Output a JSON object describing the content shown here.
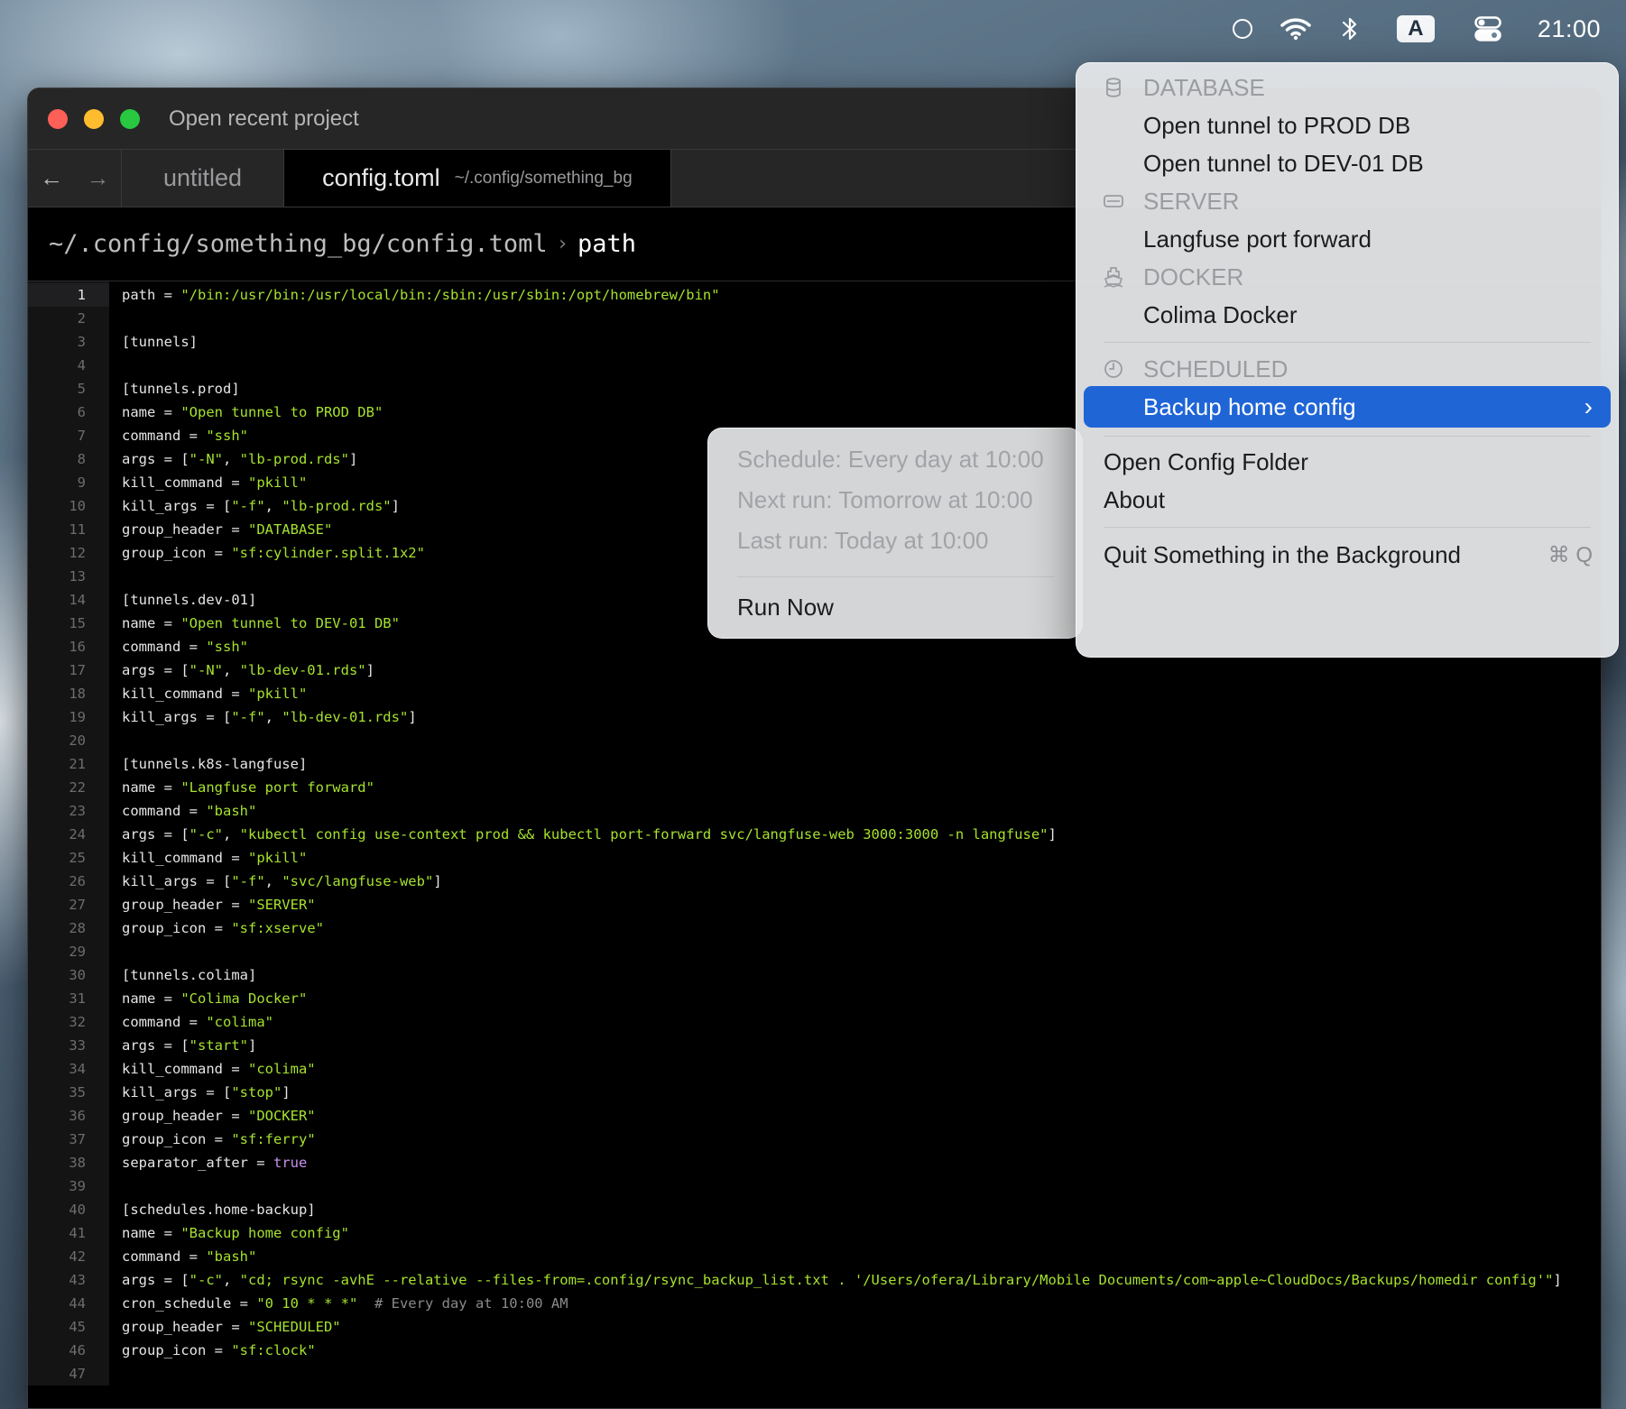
{
  "menubar": {
    "icons": [
      "circle-status-icon",
      "wifi-icon",
      "bluetooth-icon",
      "input-source-icon",
      "control-center-icon"
    ],
    "input_source": "A",
    "clock": "21:00"
  },
  "window": {
    "title": "Open recent project",
    "tabs": [
      {
        "label": "untitled",
        "sub": ""
      },
      {
        "label": "config.toml",
        "sub": "~/.config/something_bg"
      }
    ],
    "breadcrumb": {
      "path": "~/.config/something_bg/config.toml",
      "separator": "›",
      "symbol": "path"
    },
    "current_line": 1
  },
  "code_lines": [
    "path = \"/bin:/usr/bin:/usr/local/bin:/sbin:/usr/sbin:/opt/homebrew/bin\"",
    "",
    "[tunnels]",
    "",
    "[tunnels.prod]",
    "name = \"Open tunnel to PROD DB\"",
    "command = \"ssh\"",
    "args = [\"-N\", \"lb-prod.rds\"]",
    "kill_command = \"pkill\"",
    "kill_args = [\"-f\", \"lb-prod.rds\"]",
    "group_header = \"DATABASE\"",
    "group_icon = \"sf:cylinder.split.1x2\"",
    "",
    "[tunnels.dev-01]",
    "name = \"Open tunnel to DEV-01 DB\"",
    "command = \"ssh\"",
    "args = [\"-N\", \"lb-dev-01.rds\"]",
    "kill_command = \"pkill\"",
    "kill_args = [\"-f\", \"lb-dev-01.rds\"]",
    "",
    "[tunnels.k8s-langfuse]",
    "name = \"Langfuse port forward\"",
    "command = \"bash\"",
    "args = [\"-c\", \"kubectl config use-context prod && kubectl port-forward svc/langfuse-web 3000:3000 -n langfuse\"]",
    "kill_command = \"pkill\"",
    "kill_args = [\"-f\", \"svc/langfuse-web\"]",
    "group_header = \"SERVER\"",
    "group_icon = \"sf:xserve\"",
    "",
    "[tunnels.colima]",
    "name = \"Colima Docker\"",
    "command = \"colima\"",
    "args = [\"start\"]",
    "kill_command = \"colima\"",
    "kill_args = [\"stop\"]",
    "group_header = \"DOCKER\"",
    "group_icon = \"sf:ferry\"",
    "separator_after = true",
    "",
    "[schedules.home-backup]",
    "name = \"Backup home config\"",
    "command = \"bash\"",
    "args = [\"-c\", \"cd; rsync -avhE --relative --files-from=.config/rsync_backup_list.txt . '/Users/ofera/Library/Mobile Documents/com~apple~CloudDocs/Backups/homedir config'\"]",
    "cron_schedule = \"0 10 * * *\"  # Every day at 10:00 AM",
    "group_header = \"SCHEDULED\"",
    "group_icon = \"sf:clock\"",
    ""
  ],
  "status_menu": {
    "database_header": "DATABASE",
    "prod_item": "Open tunnel to PROD DB",
    "dev_item": "Open tunnel to DEV-01 DB",
    "server_header": "SERVER",
    "langfuse_item": "Langfuse port forward",
    "docker_header": "DOCKER",
    "colima_item": "Colima Docker",
    "scheduled_header": "SCHEDULED",
    "backup_item": "Backup home config",
    "open_config": "Open Config Folder",
    "about": "About",
    "quit": "Quit Something in the Background",
    "quit_shortcut": "⌘ Q"
  },
  "submenu": {
    "schedule": "Schedule: Every day at 10:00",
    "next_run": "Next run: Tomorrow at 10:00",
    "last_run": "Last run: Today at 10:00",
    "run_now": "Run Now"
  },
  "colors": {
    "highlight": "#1f65d6",
    "string": "#a6e22e",
    "keyword": "#c792ea"
  }
}
